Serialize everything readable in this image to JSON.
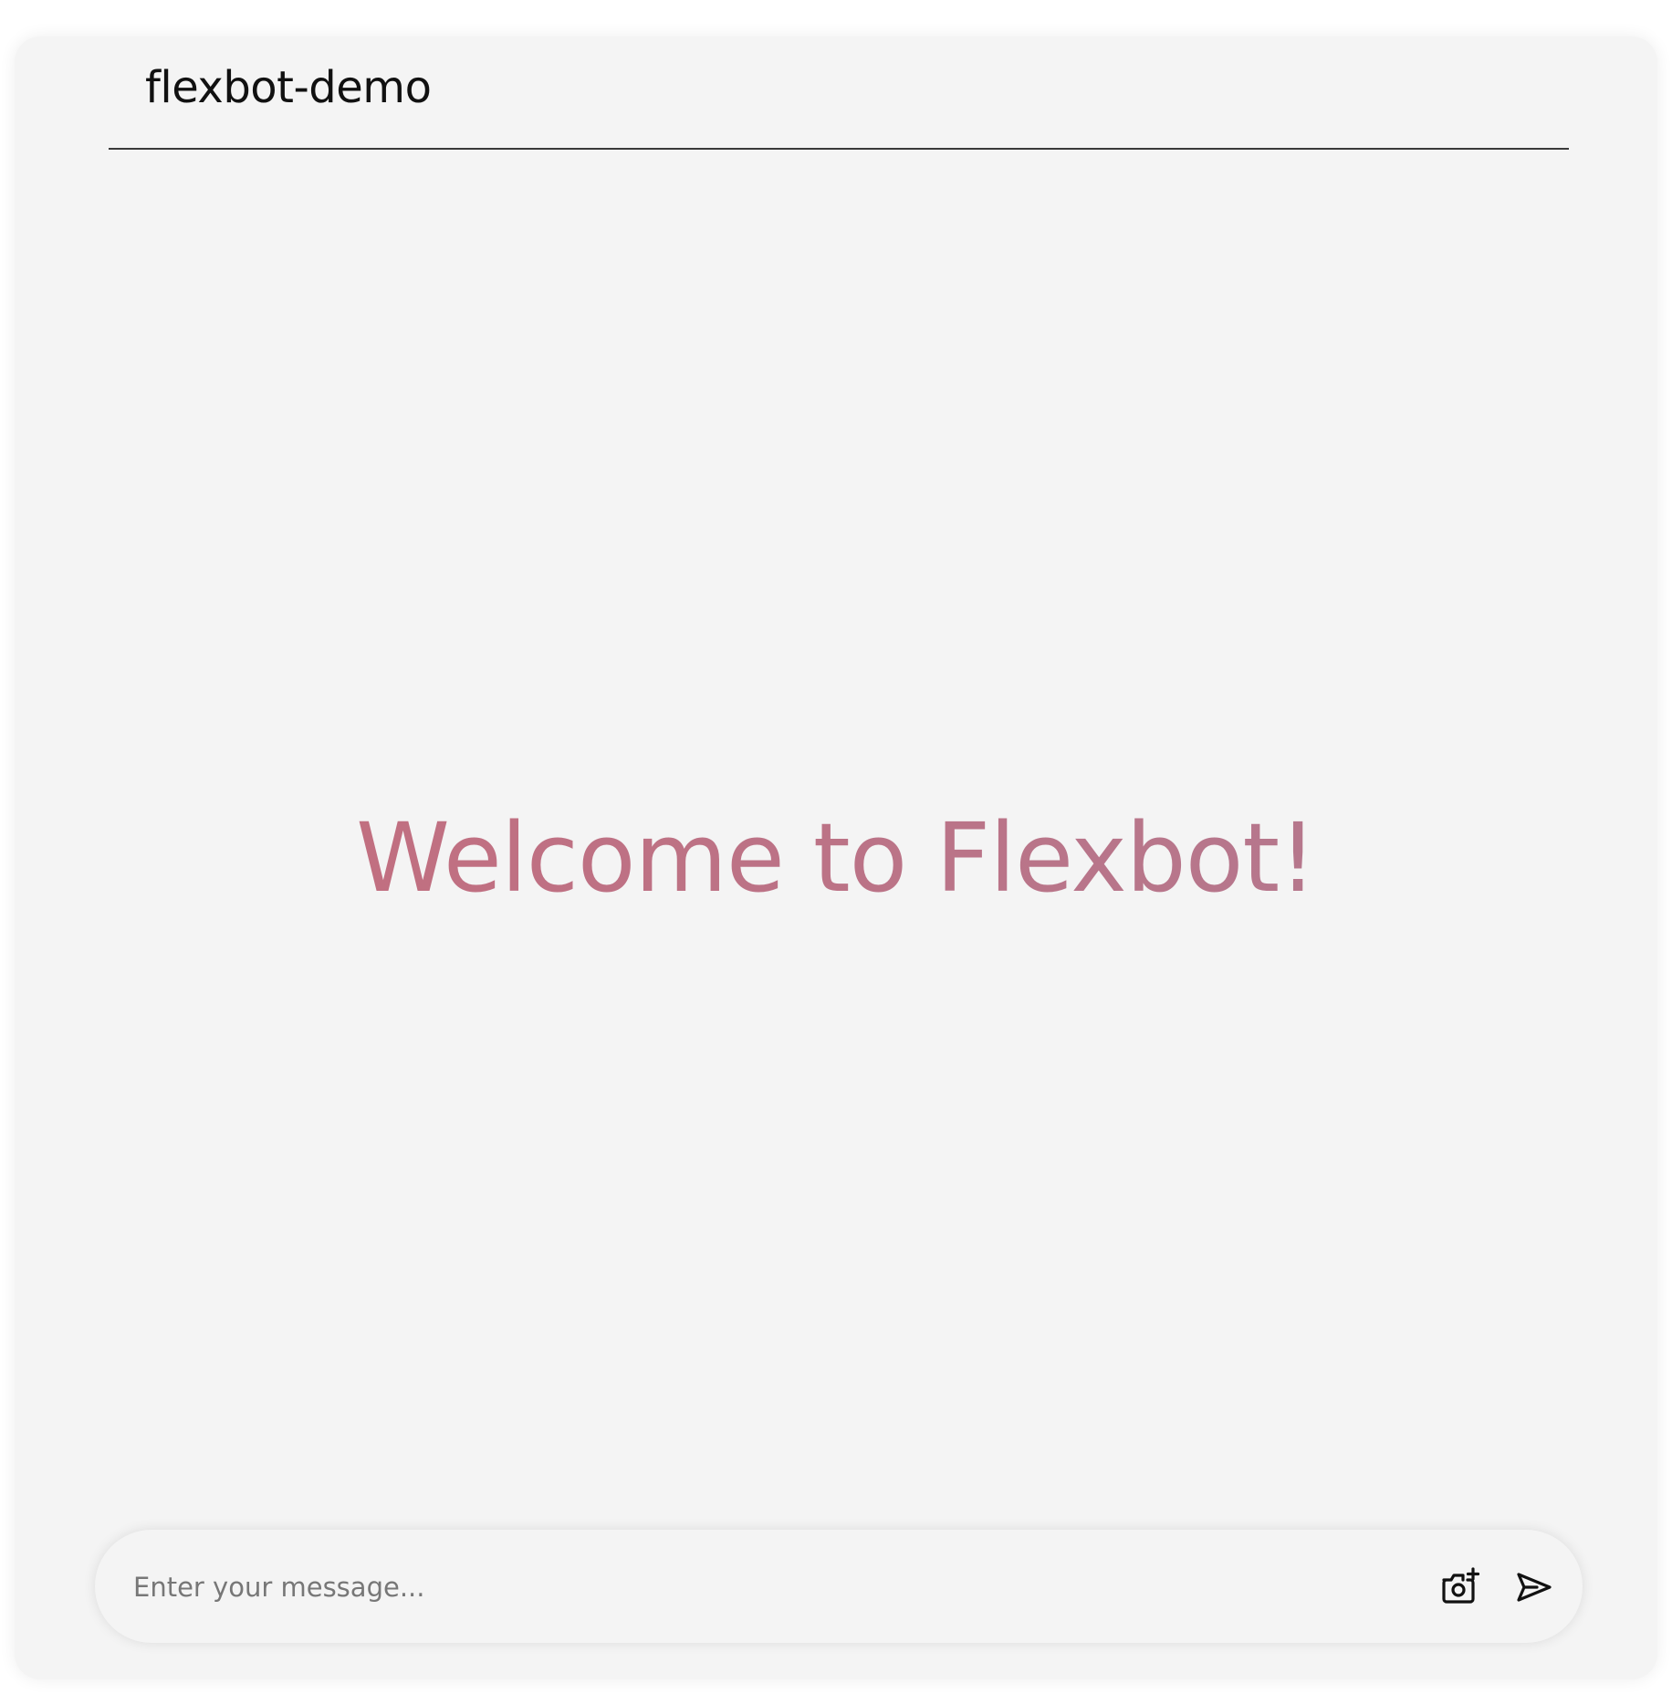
{
  "header": {
    "title": "flexbot-demo"
  },
  "main": {
    "welcome_text": "Welcome to Flexbot!",
    "welcome_gradient": [
      "#c56c7c",
      "#b27a91"
    ]
  },
  "composer": {
    "placeholder": "Enter your message...",
    "value": "",
    "attach_icon": "camera-plus-icon",
    "send_icon": "send-icon"
  },
  "colors": {
    "panel_background": "#f4f4f4",
    "page_background": "#ffffff",
    "title_text": "#111111",
    "divider": "#3a3a3a"
  }
}
